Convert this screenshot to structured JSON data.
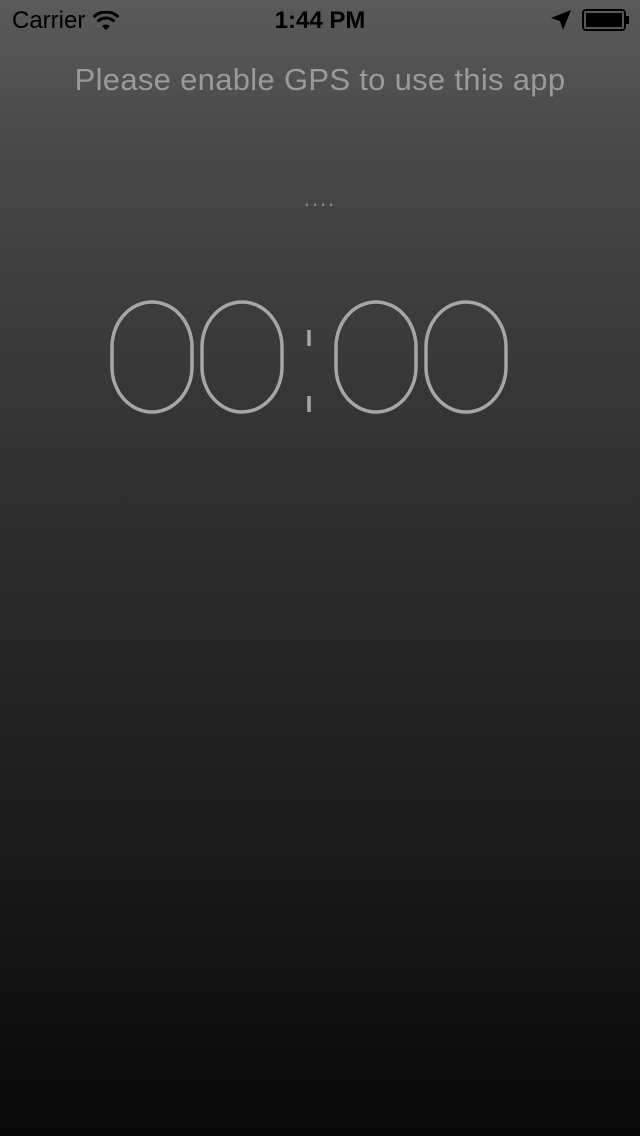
{
  "status_bar": {
    "carrier": "Carrier",
    "time": "1:44 PM",
    "icons": [
      "wifi-icon",
      "location-arrow-icon",
      "battery-icon"
    ]
  },
  "message": "Please enable GPS to use this app",
  "status_indicator": "....",
  "timer": {
    "minutes": "00",
    "seconds": "00",
    "separator": ":"
  },
  "colors": {
    "gradient_top": "#5a5a5a",
    "gradient_bottom": "#080808",
    "text": "#9a9a9a",
    "digits_stroke": "#a6a6a6"
  }
}
